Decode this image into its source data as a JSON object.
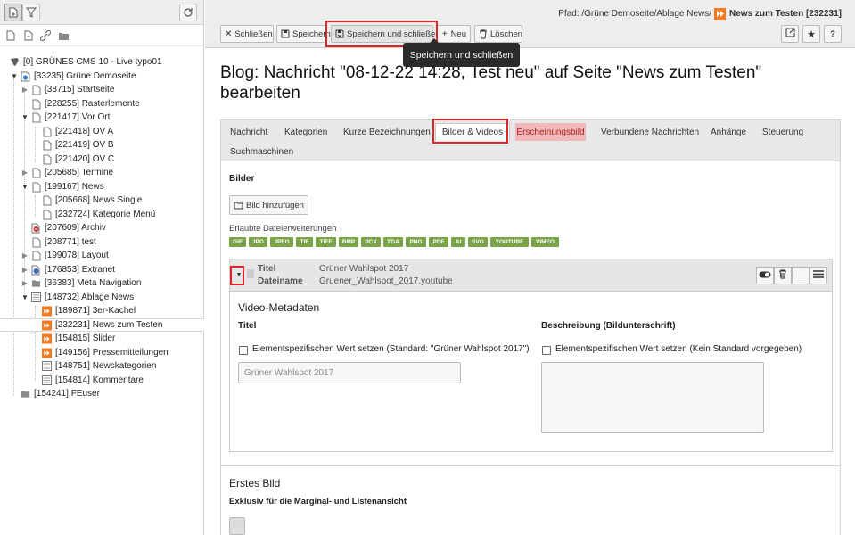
{
  "tree": {
    "nodes": [
      {
        "label": "[0] GRÜNES CMS 10 - Live typo01",
        "icon": "typo3-logo-icon",
        "depth": 0,
        "toggle": ""
      },
      {
        "label": "[33235] Grüne Demoseite",
        "icon": "site-root-icon",
        "depth": 1,
        "toggle": "down"
      },
      {
        "label": "[38715] Startseite",
        "icon": "page-icon",
        "depth": 2,
        "toggle": "right"
      },
      {
        "label": "[228255] Rasterlemente",
        "icon": "page-icon",
        "depth": 2,
        "toggle": ""
      },
      {
        "label": "[221417] Vor Ort",
        "icon": "page-icon",
        "depth": 2,
        "toggle": "down"
      },
      {
        "label": "[221418] OV A",
        "icon": "page-icon",
        "depth": 3,
        "toggle": ""
      },
      {
        "label": "[221419] OV B",
        "icon": "page-icon",
        "depth": 3,
        "toggle": ""
      },
      {
        "label": "[221420] OV C",
        "icon": "page-icon",
        "depth": 3,
        "toggle": ""
      },
      {
        "label": "[205685] Termine",
        "icon": "page-icon",
        "depth": 2,
        "toggle": "right"
      },
      {
        "label": "[199167] News",
        "icon": "page-icon",
        "depth": 2,
        "toggle": "down"
      },
      {
        "label": "[205668] News Single",
        "icon": "page-icon",
        "depth": 3,
        "toggle": ""
      },
      {
        "label": "[232724] Kategorie Menü",
        "icon": "page-icon",
        "depth": 3,
        "toggle": ""
      },
      {
        "label": "[207609] Archiv",
        "icon": "page-hidden-icon",
        "depth": 2,
        "toggle": ""
      },
      {
        "label": "[208771] test",
        "icon": "page-icon",
        "depth": 2,
        "toggle": ""
      },
      {
        "label": "[199078] Layout",
        "icon": "page-icon",
        "depth": 2,
        "toggle": "right"
      },
      {
        "label": "[176853] Extranet",
        "icon": "page-login-icon",
        "depth": 2,
        "toggle": "right"
      },
      {
        "label": "[36383] Meta Navigation",
        "icon": "folder-icon",
        "depth": 2,
        "toggle": "right"
      },
      {
        "label": "[148732] Ablage News",
        "icon": "sysfolder-icon",
        "depth": 2,
        "toggle": "down"
      },
      {
        "label": "[189871] 3er-Kachel",
        "icon": "news-folder-icon",
        "depth": 3,
        "toggle": ""
      },
      {
        "label": "[232231] News zum Testen",
        "icon": "news-folder-icon",
        "depth": 3,
        "toggle": "",
        "selected": true
      },
      {
        "label": "[154815] Slider",
        "icon": "news-folder-icon",
        "depth": 3,
        "toggle": ""
      },
      {
        "label": "[149156] Pressemitteilungen",
        "icon": "news-folder-icon",
        "depth": 3,
        "toggle": ""
      },
      {
        "label": "[148751] Newskategorien",
        "icon": "sysfolder-icon",
        "depth": 3,
        "toggle": ""
      },
      {
        "label": "[154814] Kommentare",
        "icon": "sysfolder-icon",
        "depth": 3,
        "toggle": ""
      },
      {
        "label": "[154241] FEuser",
        "icon": "folder-icon",
        "depth": 1,
        "toggle": ""
      }
    ]
  },
  "header": {
    "path_label": "Pfad: /Grüne Demoseite/Ablage News/",
    "record_title": "News zum Testen [232231]",
    "buttons": {
      "close": "Schließen",
      "save": "Speichern",
      "save_close": "Speichern und schließen",
      "new": "Neu",
      "delete": "Löschen"
    },
    "tooltip": "Speichern und schließen"
  },
  "page": {
    "title": "Blog: Nachricht \"08-12-22 14:28, Test neu\" auf Seite \"News zum Testen\" bearbeiten"
  },
  "tabs": [
    {
      "label": "Nachricht",
      "state": "normal"
    },
    {
      "label": "Kategorien",
      "state": "normal"
    },
    {
      "label": "Kurze Bezeichnungen",
      "state": "normal"
    },
    {
      "label": "Bilder & Videos",
      "state": "active"
    },
    {
      "label": "Erscheinungsbild",
      "state": "error"
    },
    {
      "label": "Verbundene Nachrichten",
      "state": "normal"
    },
    {
      "label": "Anhänge",
      "state": "normal"
    },
    {
      "label": "Steuerung",
      "state": "normal"
    },
    {
      "label": "Suchmaschinen",
      "state": "normal"
    }
  ],
  "images_section": {
    "heading": "Bilder",
    "add_button": "Bild hinzufügen",
    "allowed_label": "Erlaubte Dateierweiterungen",
    "extensions": [
      "GIF",
      "JPG",
      "JPEG",
      "TIF",
      "TIFF",
      "BMP",
      "PCX",
      "TGA",
      "PNG",
      "PDF",
      "AI",
      "SVG",
      "YOUTUBE",
      "VIMEO"
    ]
  },
  "media_item": {
    "title_label": "Titel",
    "title_value": "Grüner Wahlspot 2017",
    "filename_label": "Dateiname",
    "filename_value": "Gruener_Wahlspot_2017.youtube",
    "metadata_heading": "Video-Metadaten",
    "col_title_heading": "Titel",
    "col_title_checkbox": "Elementspezifischen Wert setzen (Standard: \"Grüner Wahlspot 2017\")",
    "col_title_placeholder": "Grüner Wahlspot 2017",
    "col_desc_heading": "Beschreibung (Bildunterschrift)",
    "col_desc_checkbox": "Elementspezifischen Wert setzen (Kein Standard vorgegeben)"
  },
  "first_image": {
    "heading": "Erstes Bild",
    "subheading": "Exklusiv für die Marginal- und Listenansicht"
  },
  "colors": {
    "accent_red": "#e0242a",
    "badge_green": "#79a548",
    "news_orange": "#f47a20"
  }
}
